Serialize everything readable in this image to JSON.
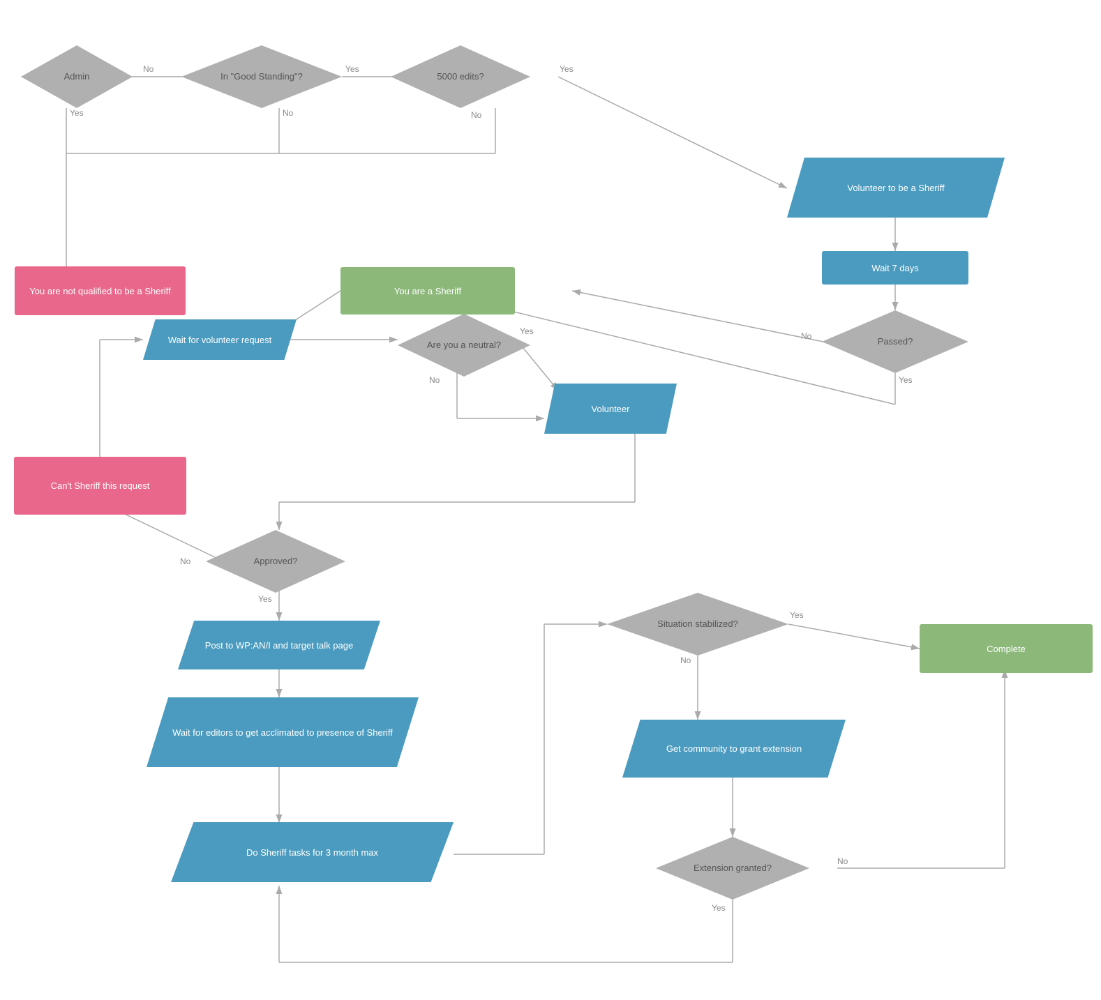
{
  "nodes": {
    "admin_diamond": {
      "label": "Admin"
    },
    "good_standing_diamond": {
      "label": "In \"Good Standing\"?"
    },
    "edits_diamond": {
      "label": "5000 edits?"
    },
    "volunteer_para": {
      "label": "Volunteer to be a Sheriff"
    },
    "wait7_rect": {
      "label": "Wait 7 days"
    },
    "passed_diamond": {
      "label": "Passed?"
    },
    "not_qualified_rect": {
      "label": "You are not qualified\nto be a Sheriff"
    },
    "you_are_sheriff_rect": {
      "label": "You are a Sheriff"
    },
    "wait_volunteer_para": {
      "label": "Wait for volunteer request"
    },
    "neutral_diamond": {
      "label": "Are you\na neutral?"
    },
    "volunteer2_para": {
      "label": "Volunteer"
    },
    "cant_sheriff_rect": {
      "label": "Can't Sheriff this request"
    },
    "approved_diamond": {
      "label": "Approved?"
    },
    "post_para": {
      "label": "Post to WP:AN/I and\ntarget talk page"
    },
    "wait_editors_para": {
      "label": "Wait for editors to get\nacclimated to presence\nof Sheriff"
    },
    "do_tasks_para": {
      "label": "Do Sheriff tasks for\n3 month max"
    },
    "situation_diamond": {
      "label": "Situation stabilized?"
    },
    "complete_rect": {
      "label": "Complete"
    },
    "get_community_para": {
      "label": "Get community\nto grant extension"
    },
    "extension_diamond": {
      "label": "Extension\ngranted?"
    }
  },
  "arrow_labels": {
    "admin_no": "No",
    "admin_yes": "Yes",
    "good_standing_yes": "Yes",
    "good_standing_no": "No",
    "edits_yes": "Yes",
    "edits_no": "No",
    "passed_no": "No",
    "passed_yes": "Yes",
    "neutral_yes": "Yes",
    "neutral_no": "No",
    "approved_no": "No",
    "approved_yes": "Yes",
    "situation_yes": "Yes",
    "situation_no": "No",
    "extension_no": "No",
    "extension_yes": "Yes"
  }
}
